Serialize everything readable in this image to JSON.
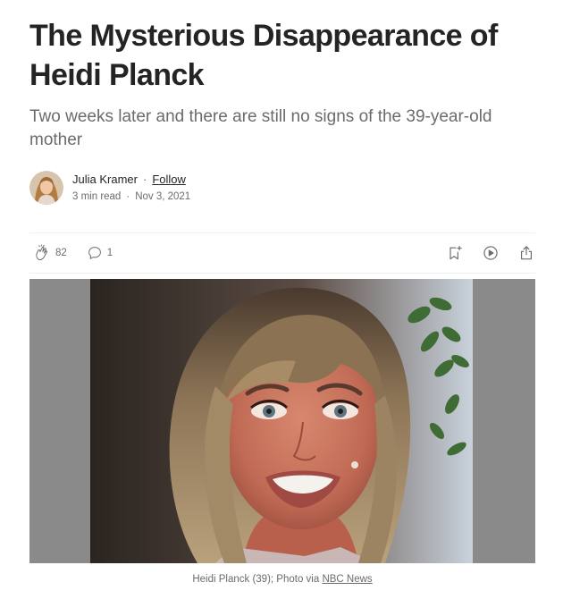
{
  "article": {
    "title": "The Mysterious Disappearance of Heidi Planck",
    "subtitle": "Two weeks later and there are still no signs of the 39-year-old mother"
  },
  "byline": {
    "author": "Julia Kramer",
    "separator": "·",
    "follow_label": "Follow",
    "read_time": "3 min read",
    "date": "Nov 3, 2021"
  },
  "actions": {
    "clap_count": "82",
    "response_count": "1",
    "left_icons": [
      "clap-icon",
      "comment-icon"
    ],
    "right_icons": [
      "bookmark-add-icon",
      "play-icon",
      "share-icon"
    ]
  },
  "figure": {
    "caption_text": "Heidi Planck (39); Photo via ",
    "caption_link": "NBC News"
  },
  "colors": {
    "text_primary": "#242424",
    "text_secondary": "#6b6b6b",
    "divider": "#f0f0f0",
    "photo_background": "#8a8a8a"
  }
}
